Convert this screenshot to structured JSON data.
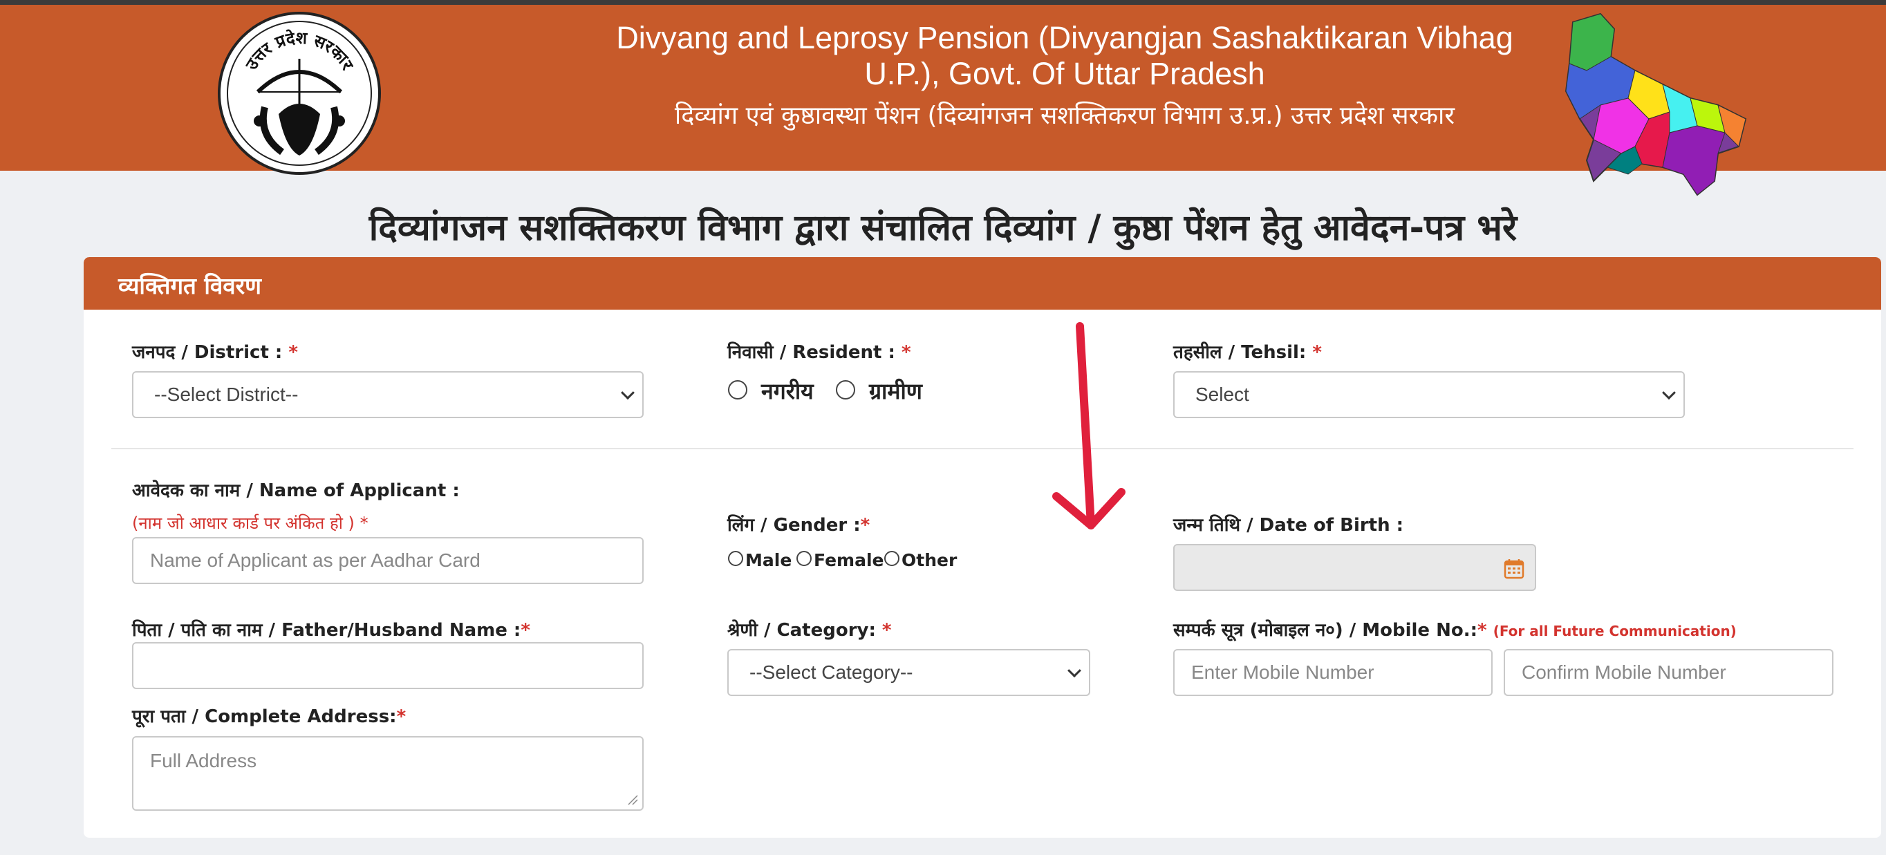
{
  "header": {
    "title_line1": "Divyang and Leprosy Pension (Divyangjan Sashaktikaran Vibhag",
    "title_line2": "U.P.), Govt. Of Uttar Pradesh",
    "subtitle": "दिव्यांग एवं कुष्ठावस्था पेंशन (दिव्यांगजन सशक्तिकरण विभाग उ.प्र.) उत्तर प्रदेश सरकार",
    "emblem_text": "उत्तर प्रदेश सरकार",
    "emblem_icon": "up-government-emblem",
    "map_icon": "uttar-pradesh-district-map"
  },
  "page_heading": "दिव्यांगजन सशक्तिकरण विभाग द्वारा संचालित दिव्यांग / कुष्ठा पेंशन हेतु आवेदन-पत्र भरे",
  "section": {
    "title": "व्यक्तिगत विवरण"
  },
  "form": {
    "district": {
      "label": "जनपद / District : ",
      "required": "*",
      "value": "--Select District--"
    },
    "resident": {
      "label": "निवासी / Resident : ",
      "required": "*",
      "options": [
        "नगरीय",
        "ग्रामीण"
      ]
    },
    "tehsil": {
      "label": "तहसील / Tehsil: ",
      "required": "*",
      "value": "Select"
    },
    "applicant_name": {
      "label": "आवेदक का नाम / Name of Applicant :",
      "hint": "(नाम जो आधार कार्ड पर अंकित हो ) ",
      "required": "*",
      "placeholder": "Name of Applicant as per Aadhar Card"
    },
    "gender": {
      "label": "लिंग / Gender :",
      "required": "*",
      "options": [
        "Male",
        "Female",
        "Other"
      ]
    },
    "dob": {
      "label": "जन्म तिथि / Date of Birth :",
      "value": ""
    },
    "father_name": {
      "label": "पिता / पति का नाम / Father/Husband Name :",
      "required": "*",
      "value": ""
    },
    "category": {
      "label": "श्रेणी / Category: ",
      "required": "*",
      "value": "--Select Category--"
    },
    "mobile": {
      "label": "सम्पर्क सूत्र (मोबाइल न०) / Mobile No.:",
      "required": "*",
      "note": "(For all Future Communication)",
      "placeholder": "Enter Mobile Number",
      "confirm_placeholder": "Confirm Mobile Number"
    },
    "address": {
      "label": "पूरा पता / Complete Address:",
      "required": "*",
      "placeholder": "Full Address"
    }
  },
  "annotation": {
    "color": "#e0203c",
    "icon": "red-down-arrow"
  },
  "colors": {
    "brand": "#c75a2a",
    "required": "#d3332e",
    "page_bg": "#eef0f3"
  }
}
